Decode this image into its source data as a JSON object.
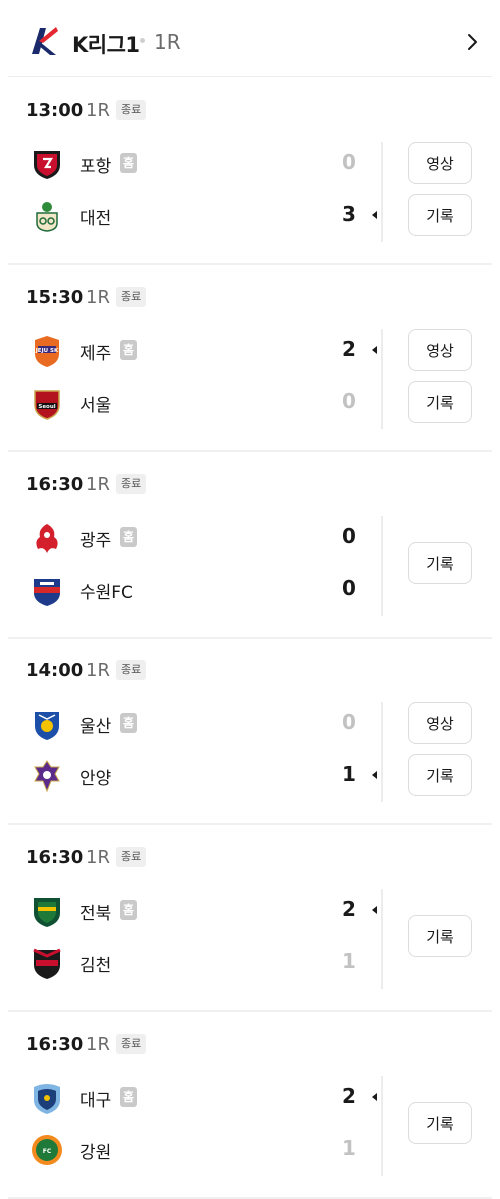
{
  "header": {
    "league": "K리그1",
    "round": "1R",
    "logo_icon": "k-league-logo",
    "nav_icon": "chevron-right-icon"
  },
  "matches": [
    {
      "time": "13:00",
      "round": "1R",
      "status": "종료",
      "home": {
        "name": "포항",
        "badge": "홈",
        "score": "0",
        "winner": false
      },
      "away": {
        "name": "대전",
        "score": "3",
        "winner": true
      },
      "buttons": [
        "영상",
        "기록"
      ]
    },
    {
      "time": "15:30",
      "round": "1R",
      "status": "종료",
      "home": {
        "name": "제주",
        "badge": "홈",
        "score": "2",
        "winner": true
      },
      "away": {
        "name": "서울",
        "score": "0",
        "winner": false
      },
      "buttons": [
        "영상",
        "기록"
      ]
    },
    {
      "time": "16:30",
      "round": "1R",
      "status": "종료",
      "home": {
        "name": "광주",
        "badge": "홈",
        "score": "0",
        "winner": false
      },
      "away": {
        "name": "수원FC",
        "score": "0",
        "winner": false
      },
      "draw": true,
      "buttons": [
        "기록"
      ]
    },
    {
      "time": "14:00",
      "round": "1R",
      "status": "종료",
      "home": {
        "name": "울산",
        "badge": "홈",
        "score": "0",
        "winner": false
      },
      "away": {
        "name": "안양",
        "score": "1",
        "winner": true
      },
      "buttons": [
        "영상",
        "기록"
      ]
    },
    {
      "time": "16:30",
      "round": "1R",
      "status": "종료",
      "home": {
        "name": "전북",
        "badge": "홈",
        "score": "2",
        "winner": true
      },
      "away": {
        "name": "김천",
        "score": "1",
        "winner": false
      },
      "buttons": [
        "기록"
      ]
    },
    {
      "time": "16:30",
      "round": "1R",
      "status": "종료",
      "home": {
        "name": "대구",
        "badge": "홈",
        "score": "2",
        "winner": true
      },
      "away": {
        "name": "강원",
        "score": "1",
        "winner": false
      },
      "buttons": [
        "기록"
      ]
    }
  ],
  "colors": {
    "text": "#1a1a1a",
    "muted": "#6b6b6b",
    "loser_score": "#c2c2c2",
    "home_badge": "#c9c9c9",
    "status_bg": "#efefef"
  }
}
